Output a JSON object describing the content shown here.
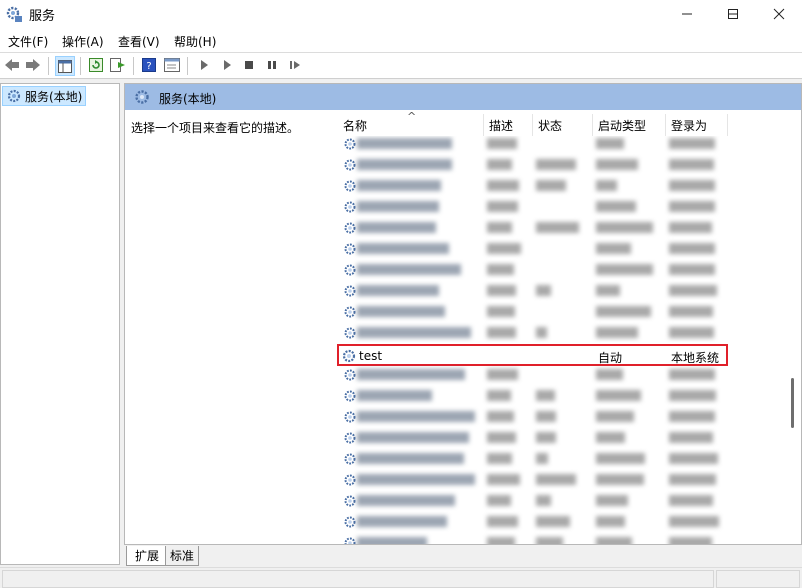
{
  "window": {
    "title": "服务",
    "minimize_icon": "minimize-icon",
    "maximize_icon": "maximize-icon",
    "close_icon": "close-icon"
  },
  "menu": [
    {
      "label": "文件(F)"
    },
    {
      "label": "操作(A)"
    },
    {
      "label": "查看(V)"
    },
    {
      "label": "帮助(H)"
    }
  ],
  "toolbar": {
    "buttons": [
      "back-icon",
      "forward-icon",
      "show-hide-tree-icon",
      "refresh-icon",
      "export-list-icon",
      "help-icon",
      "properties-icon",
      "start-service-icon",
      "start-service-alt-icon",
      "stop-service-icon",
      "pause-service-icon",
      "resume-service-icon"
    ]
  },
  "tree": {
    "root_label": "服务(本地)"
  },
  "panel": {
    "header": "服务(本地)",
    "description_prompt": "选择一个项目来查看它的描述。"
  },
  "list": {
    "columns": [
      "名称",
      "描述",
      "状态",
      "启动类型",
      "登录为"
    ],
    "highlighted_row": {
      "name": "test",
      "description": "",
      "status": "",
      "startup": "自动",
      "logon": "本地系统"
    }
  },
  "tabs": [
    "扩展",
    "标准"
  ]
}
